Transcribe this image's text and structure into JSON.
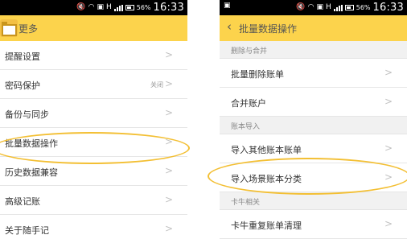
{
  "left_screen": {
    "status": {
      "time": "16:33",
      "battery": "56%",
      "net": "H"
    },
    "header_title": "更多",
    "rows": [
      {
        "label": "提醒设置",
        "value": ""
      },
      {
        "label": "密码保护",
        "value": "关闭"
      },
      {
        "label": "备份与同步",
        "value": ""
      },
      {
        "label": "批量数据操作",
        "value": ""
      },
      {
        "label": "历史数据兼容",
        "value": ""
      },
      {
        "label": "高级记账",
        "value": ""
      },
      {
        "label": "关于随手记",
        "value": ""
      }
    ]
  },
  "right_screen": {
    "status": {
      "time": "16:33",
      "battery": "56%",
      "net": "H"
    },
    "header_title": "批量数据操作",
    "sections": [
      {
        "label": "删除与合并",
        "rows": [
          {
            "label": "批量删除账单"
          },
          {
            "label": "合并账户"
          }
        ]
      },
      {
        "label": "账本导入",
        "rows": [
          {
            "label": "导入其他账本账单"
          },
          {
            "label": "导入场景账本分类"
          }
        ]
      },
      {
        "label": "卡牛相关",
        "rows": [
          {
            "label": "卡牛重复账单清理"
          }
        ]
      }
    ]
  },
  "icons": {
    "chevron": "chevron-right-icon",
    "back": "chevron-left-icon",
    "wifi": "wifi-icon",
    "signal": "signal-icon",
    "battery": "battery-icon"
  },
  "colors": {
    "header": "#fcd34c",
    "highlight": "#f3bf33",
    "section_bg": "#f1f1f1"
  }
}
